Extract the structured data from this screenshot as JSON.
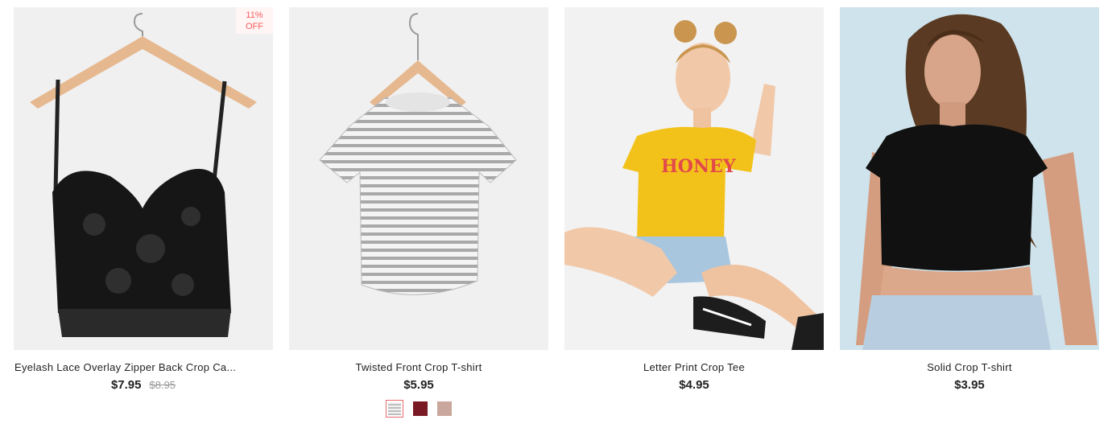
{
  "products": [
    {
      "title": "Eyelash Lace Overlay Zipper Back Crop Ca...",
      "price": "$7.95",
      "old_price": "$8.95",
      "badge_line1": "11%",
      "badge_line2": "OFF",
      "image_icon": "black-lace-cami-image"
    },
    {
      "title": "Twisted Front Crop T-shirt",
      "price": "$5.95",
      "image_icon": "striped-tshirt-image",
      "swatches": [
        "#cfcfcf",
        "#7a1a24",
        "#c9a79d"
      ]
    },
    {
      "title": "Letter Print Crop Tee",
      "price": "$4.95",
      "image_icon": "model-yellow-tee-image",
      "print_text": "HONEY"
    },
    {
      "title": "Solid Crop T-shirt",
      "price": "$3.95",
      "image_icon": "model-black-tee-image"
    }
  ]
}
